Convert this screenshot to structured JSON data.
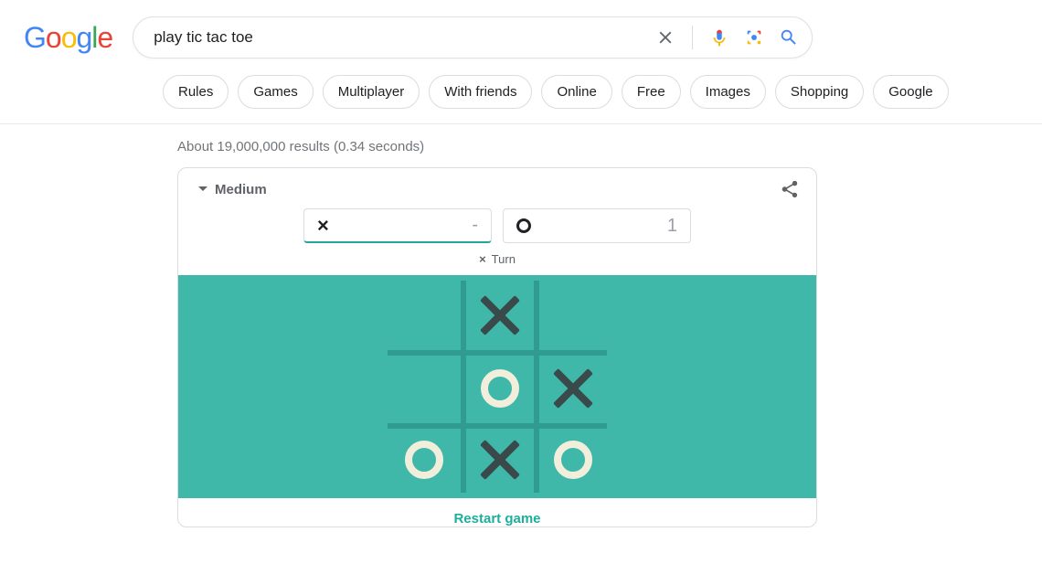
{
  "header": {
    "logo_text": "Google",
    "search_value": "play tic tac toe"
  },
  "chips": [
    "Rules",
    "Games",
    "Multiplayer",
    "With friends",
    "Online",
    "Free",
    "Images",
    "Shopping",
    "Google"
  ],
  "results_meta": "About 19,000,000 results (0.34 seconds)",
  "game": {
    "difficulty_label": "Medium",
    "score": {
      "x_symbol": "×",
      "x_value": "-",
      "o_value": "1"
    },
    "turn": {
      "symbol": "×",
      "label": "Turn"
    },
    "board": [
      [
        "",
        "X",
        ""
      ],
      [
        "",
        "O",
        "X"
      ],
      [
        "O",
        "X",
        "O"
      ]
    ],
    "restart_label": "Restart game"
  }
}
